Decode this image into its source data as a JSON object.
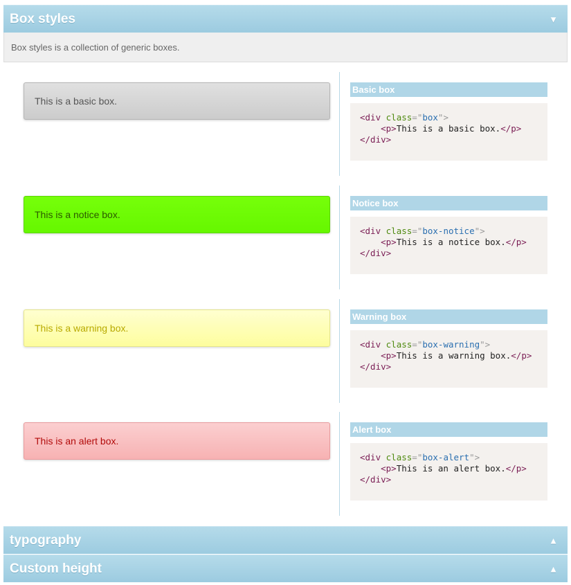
{
  "panels": {
    "box_styles": {
      "title": "Box styles",
      "arrow": "▼",
      "description": "Box styles is a collection of generic boxes."
    },
    "typography": {
      "title": "typography",
      "arrow": "▲"
    },
    "custom_height": {
      "title": "Custom height",
      "arrow": "▲"
    }
  },
  "boxes": [
    {
      "demo_text": "This is a basic box.",
      "code_title": "Basic box",
      "class_name": "box",
      "inner_text": "This is a basic box."
    },
    {
      "demo_text": "This is a notice box.",
      "code_title": "Notice box",
      "class_name": "box-notice",
      "inner_text": "This is a notice box."
    },
    {
      "demo_text": "This is a warning box.",
      "code_title": "Warning box",
      "class_name": "box-warning",
      "inner_text": "This is a warning box."
    },
    {
      "demo_text": "This is an alert box.",
      "code_title": "Alert box",
      "class_name": "box-alert",
      "inner_text": "This is an alert box."
    }
  ],
  "code": {
    "open_div": "<div",
    "class_attr": "class",
    "eq": "=",
    "quote": "\"",
    "gt": ">",
    "open_p": "<p>",
    "close_p": "</p>",
    "close_div": "</div>"
  },
  "colors": {
    "header": "#a9d3e6",
    "notice": "#6cfc00",
    "warning": "#fefeb0",
    "alert": "#f9c0c1",
    "basic": "#d4d4d4"
  }
}
